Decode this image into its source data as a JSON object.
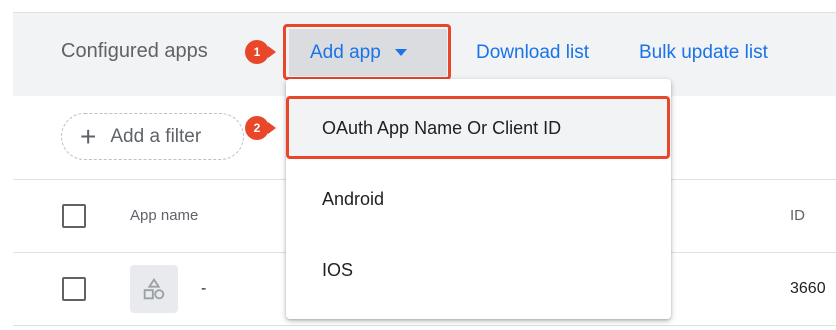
{
  "header": {
    "title": "Configured apps",
    "add_app_label": "Add app",
    "download_label": "Download list",
    "bulk_update_label": "Bulk update list"
  },
  "steps": {
    "one": "1",
    "two": "2"
  },
  "filter": {
    "add_filter_label": "Add a filter"
  },
  "table": {
    "columns": {
      "app_name": "App name",
      "id": "ID"
    },
    "rows": [
      {
        "app_name": "-",
        "id": "3660"
      }
    ]
  },
  "menu": {
    "items": [
      {
        "label": "OAuth App Name Or Client ID"
      },
      {
        "label": "Android"
      },
      {
        "label": "IOS"
      }
    ]
  },
  "icons": {
    "add_filter": "plus-icon",
    "app": "shapes-icon",
    "dropdown": "caret-down-icon"
  },
  "colors": {
    "accent": "#1a73e8",
    "highlight": "#e8472a",
    "header_bg": "#f1f3f4"
  }
}
